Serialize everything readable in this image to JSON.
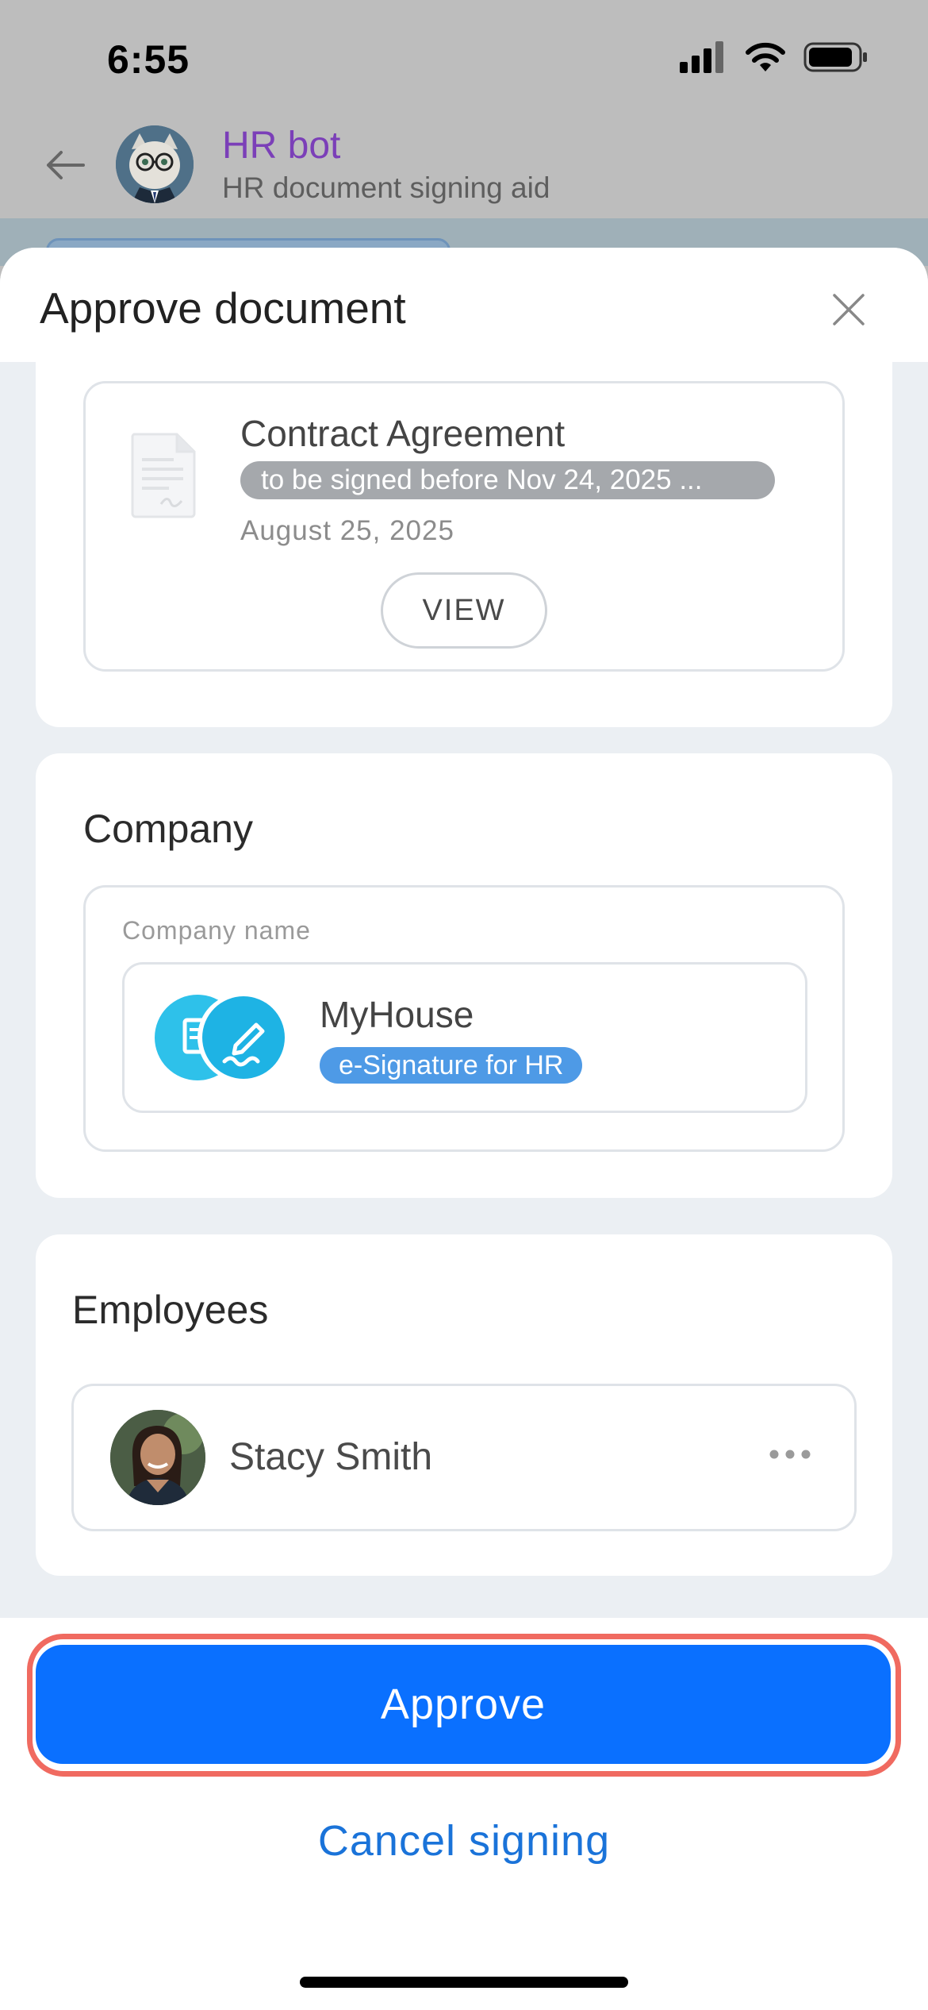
{
  "status_bar": {
    "time": "6:55"
  },
  "chat": {
    "bot_name": "HR bot",
    "bot_subtitle": "HR document signing aid"
  },
  "sheet": {
    "title": "Approve document",
    "document": {
      "title": "Contract Agreement",
      "badge": "to be signed before Nov 24, 2025 ...",
      "date": "August 25, 2025",
      "view_label": "VIEW"
    },
    "company": {
      "section_title": "Company",
      "field_label": "Company name",
      "name": "MyHouse",
      "badge": "e-Signature for HR"
    },
    "employees": {
      "section_title": "Employees",
      "items": [
        {
          "name": "Stacy Smith"
        }
      ]
    }
  },
  "footer": {
    "approve_label": "Approve",
    "cancel_label": "Cancel signing"
  },
  "colors": {
    "accent": "#0a70ff",
    "highlight": "#f06a60",
    "link": "#1a73d9",
    "bot_name": "#7b3fb8",
    "badge_grey": "#a5a8ac",
    "badge_blue": "#4e9ae6"
  }
}
